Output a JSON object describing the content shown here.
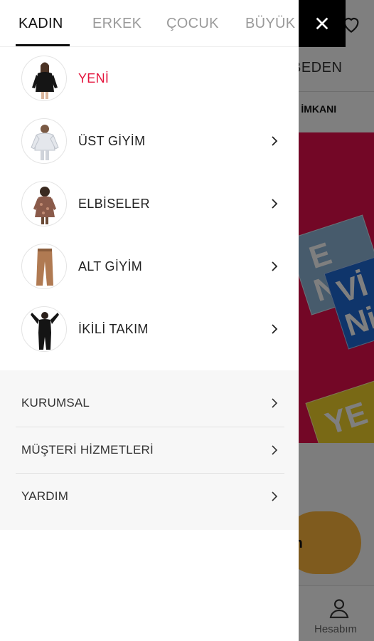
{
  "drawer": {
    "tabs": [
      {
        "label": "KADIN"
      },
      {
        "label": "ERKEK"
      },
      {
        "label": "ÇOCUK"
      },
      {
        "label": "BÜYÜK BEDEN"
      }
    ],
    "categories": [
      {
        "label": "YENİ",
        "icon": "dress-model-thumb",
        "highlight": "#e4143c"
      },
      {
        "label": "ÜST GİYİM",
        "icon": "top-model-thumb"
      },
      {
        "label": "ELBİSELER",
        "icon": "dress-model-thumb"
      },
      {
        "label": "ALT GİYİM",
        "icon": "pants-thumb"
      },
      {
        "label": "İKİLİ TAKIM",
        "icon": "suit-model-thumb"
      }
    ],
    "info_links": [
      {
        "label": "KURUMSAL"
      },
      {
        "label": "MÜŞTERİ HİZMETLERİ"
      },
      {
        "label": "YARDIM"
      }
    ]
  },
  "background": {
    "size_label": "BEDEN",
    "promo_text": "DE İMKANI",
    "banner_tiles": [
      "E",
      "Ni",
      "YE"
    ],
    "banner_tiles_2": [
      "Vİ",
      "Ni",
      "Ni"
    ],
    "pill_text": "m",
    "account_label": "Hesabım"
  },
  "colors": {
    "accent_red": "#e4143c",
    "banner": "#e60f4d",
    "close_bg": "#000000"
  }
}
